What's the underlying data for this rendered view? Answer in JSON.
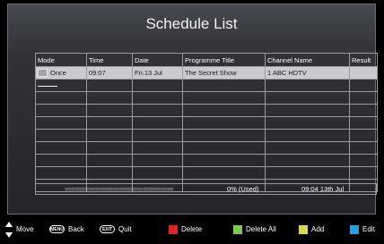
{
  "title": "Schedule List",
  "columns": [
    "Mode",
    "Time",
    "Date",
    "Programme Title",
    "Channel Name",
    "Result"
  ],
  "rows": [
    {
      "mode": "Once",
      "time": "09:07",
      "date": "Fri.13 Jul",
      "programme": "The Secret Show",
      "channel": "1 ABC HDTV",
      "result": ""
    }
  ],
  "usage": {
    "bar_text": "================================",
    "percent": "0%  (Used)",
    "clock": "09:04  13th  Jul"
  },
  "footer": {
    "move": "Move",
    "menu_key": "MENU",
    "back": "Back",
    "exit_key": "EXIT",
    "quit": "Quit",
    "delete": "Delete",
    "delete_all": "Delete All",
    "add": "Add",
    "edit": "Edit"
  },
  "colors": {
    "red": "#e0242a",
    "green": "#7ec84a",
    "yellow": "#d7d94a",
    "blue": "#2a9fe0"
  },
  "icons": [
    "updown-arrows-icon",
    "menu-key-icon",
    "exit-key-icon",
    "red-key-icon",
    "green-key-icon",
    "yellow-key-icon",
    "blue-key-icon"
  ]
}
